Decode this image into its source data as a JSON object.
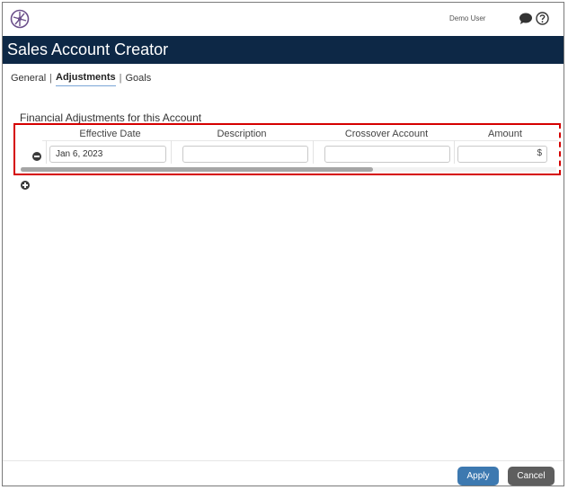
{
  "header": {
    "user_name": "Demo User",
    "logo_icon": "compass-logo",
    "chat_icon": "speech-bubble-icon",
    "help_icon": "question-circle-icon",
    "title_bar_color": "#0d2846"
  },
  "page": {
    "title": "Sales Account Creator"
  },
  "tabs": [
    {
      "label": "General",
      "active": false
    },
    {
      "label": "Adjustments",
      "active": true
    },
    {
      "label": "Goals",
      "active": false
    }
  ],
  "tab_separator": "|",
  "adjustments": {
    "section_title": "Financial Adjustments for this Account",
    "columns": [
      "Effective Date",
      "Description",
      "Crossover Account",
      "Amount"
    ],
    "rows": [
      {
        "effective_date": "Jan 6, 2023",
        "description": "",
        "crossover_account": "",
        "amount": "",
        "currency_symbol": "$"
      }
    ],
    "highlight_color": "#d50000"
  },
  "footer": {
    "apply_label": "Apply",
    "cancel_label": "Cancel",
    "apply_color": "#3d79b0",
    "cancel_color": "#5e5e5e"
  }
}
